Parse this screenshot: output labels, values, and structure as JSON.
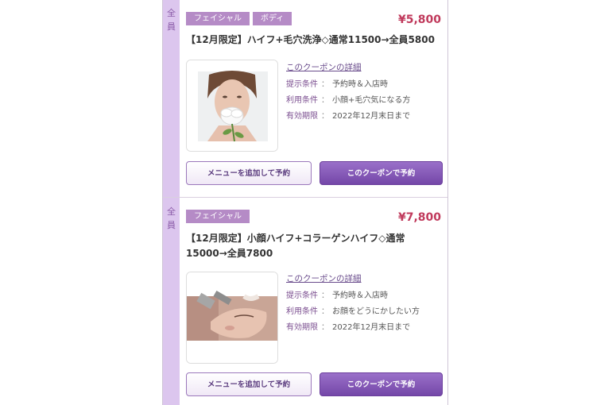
{
  "coupons": [
    {
      "side_label": "全員",
      "tags": [
        "フェイシャル",
        "ボディ"
      ],
      "price": "¥5,800",
      "title": "【12月限定】ハイフ+毛穴洗浄◇通常11500→全員5800",
      "detail_link": "このクーポンの詳細",
      "rows": [
        {
          "key": "提示条件",
          "value": "予約時＆入店時"
        },
        {
          "key": "利用条件",
          "value": "小顔+毛穴気になる方"
        },
        {
          "key": "有効期限",
          "value": "2022年12月末日まで"
        }
      ],
      "add_menu_label": "メニューを追加して予約",
      "reserve_label": "このクーポンで予約"
    },
    {
      "side_label": "全員",
      "tags": [
        "フェイシャル"
      ],
      "price": "¥7,800",
      "title": "【12月限定】小顔ハイフ+コラーゲンハイフ◇通常15000→全員7800",
      "detail_link": "このクーポンの詳細",
      "rows": [
        {
          "key": "提示条件",
          "value": "予約時＆入店時"
        },
        {
          "key": "利用条件",
          "value": "お顔をどうにかしたい方"
        },
        {
          "key": "有効期限",
          "value": "2022年12月末日まで"
        }
      ],
      "add_menu_label": "メニューを追加して予約",
      "reserve_label": "このクーポンで予約"
    }
  ],
  "sep": "：",
  "colors": {
    "price": "#c03a5c",
    "tag": "#b58bc6",
    "side": "#dcc6ee",
    "button": "#7447a8"
  }
}
